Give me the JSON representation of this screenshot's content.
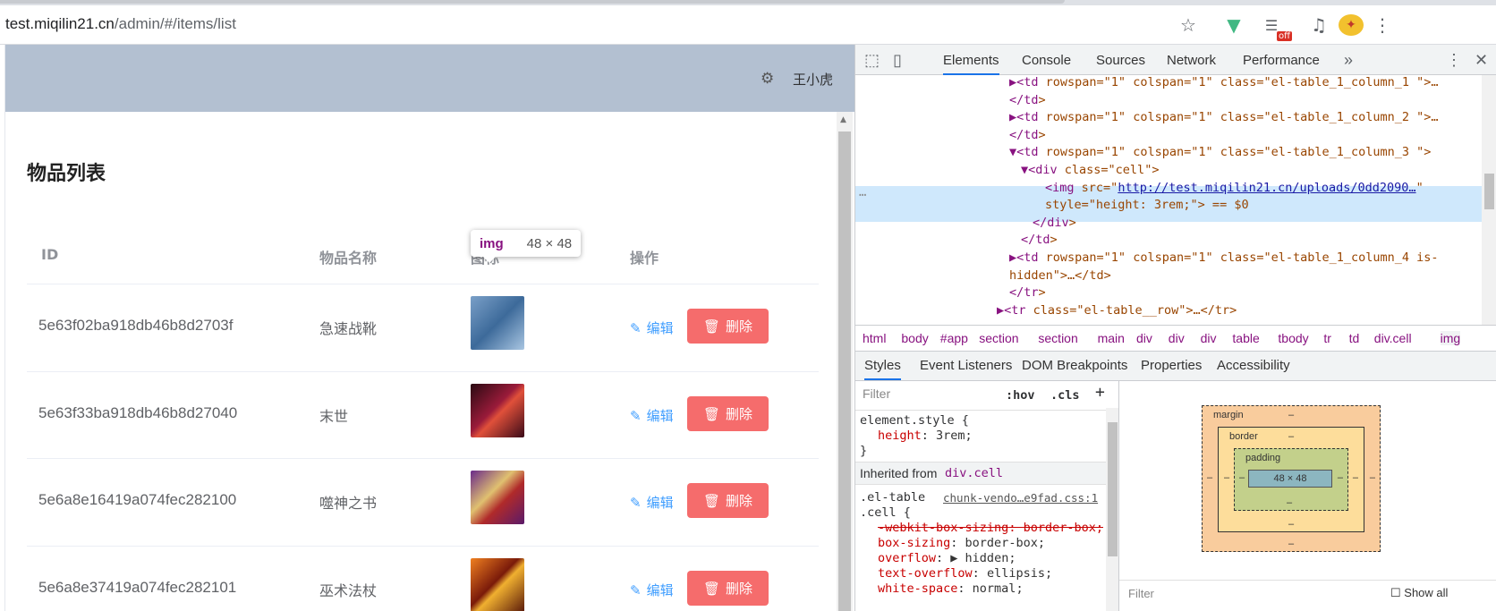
{
  "browser": {
    "url_host": "test.miqilin21.cn",
    "url_path": "/admin/#/items/list",
    "ext_badge": "off"
  },
  "app": {
    "user_name": "王小虎",
    "page_title": "物品列表",
    "columns": [
      "ID",
      "物品名称",
      "图标",
      "操作"
    ],
    "rows": [
      {
        "id": "5e63f02ba918db46b8d2703f",
        "name": "急速战靴",
        "icon": "item-icon-boots"
      },
      {
        "id": "5e63f33ba918db46b8d27040",
        "name": "末世",
        "icon": "item-icon-blade"
      },
      {
        "id": "5e6a8e16419a074fec282100",
        "name": "噬神之书",
        "icon": "item-icon-book"
      },
      {
        "id": "5e6a8e37419a074fec282101",
        "name": "巫术法杖",
        "icon": "item-icon-staff"
      }
    ],
    "edit_label": "编辑",
    "delete_label": "删除",
    "tooltip_tag": "img",
    "tooltip_dim": "48 × 48"
  },
  "devtools": {
    "tabs": [
      "Elements",
      "Console",
      "Sources",
      "Network",
      "Performance"
    ],
    "dom_lines": [
      {
        "pre": "▶<",
        "tag": "td",
        "rest": " rowspan=\"1\" colspan=\"1\" class=\"el-table_1_column_1  \">…"
      },
      {
        "pre": "</",
        "tag": "td",
        "rest": ">"
      },
      {
        "pre": "▶<",
        "tag": "td",
        "rest": " rowspan=\"1\" colspan=\"1\" class=\"el-table_1_column_2  \">…"
      },
      {
        "pre": "</",
        "tag": "td",
        "rest": ">"
      },
      {
        "pre": "▼<",
        "tag": "td",
        "rest": " rowspan=\"1\" colspan=\"1\" class=\"el-table_1_column_3  \">"
      },
      {
        "pre": "▼<",
        "tag": "div",
        "rest": " class=\"cell\">"
      },
      {
        "pre": "<",
        "tag": "img",
        "rest": " src=\"http://test.miqilin21.cn/uploads/0dd2090…\""
      },
      {
        "pre": "",
        "tag": "",
        "rest": "style=\"height: 3rem;\"> == $0"
      },
      {
        "pre": "</",
        "tag": "div",
        "rest": ">"
      },
      {
        "pre": "</",
        "tag": "td",
        "rest": ">"
      },
      {
        "pre": "▶<",
        "tag": "td",
        "rest": " rowspan=\"1\" colspan=\"1\" class=\"el-table_1_column_4   is-"
      },
      {
        "pre": "",
        "tag": "",
        "rest": "hidden\">…</td>"
      },
      {
        "pre": "</",
        "tag": "tr",
        "rest": ">"
      },
      {
        "pre": "▶<",
        "tag": "tr",
        "rest": " class=\"el-table__row\">…</tr>"
      }
    ],
    "breadcrumbs": [
      "html",
      "body",
      "#app",
      "section",
      "section",
      "main",
      "div",
      "div",
      "div",
      "table",
      "tbody",
      "tr",
      "td",
      "div.cell",
      "img"
    ],
    "styles_tabs": [
      "Styles",
      "Event Listeners",
      "DOM Breakpoints",
      "Properties",
      "Accessibility"
    ],
    "filter_placeholder": "Filter",
    "hov": ":hov",
    "cls": ".cls",
    "element_style": "element.style {",
    "element_prop": "height",
    "element_val": "3rem;",
    "inherited_label": "Inherited from",
    "inherited_from": "div.cell",
    "rule_selector_1": ".el-table",
    "rule_selector_2": ".cell {",
    "rule_source": "chunk-vendo…e9fad.css:1",
    "rule_props": [
      {
        "p": "-webkit-box-sizing",
        "v": "border-box;",
        "struck": true
      },
      {
        "p": "box-sizing",
        "v": "border-box;",
        "struck": false
      },
      {
        "p": "overflow",
        "v": "▶ hidden;",
        "struck": false
      },
      {
        "p": "text-overflow",
        "v": "ellipsis;",
        "struck": false
      },
      {
        "p": "white-space",
        "v": "normal;",
        "struck": false
      }
    ],
    "box_model": {
      "margin": "margin",
      "border": "border",
      "padding": "padding",
      "content": "48 × 48",
      "dash": "–"
    },
    "bottom_filter": "Filter",
    "show_all": "Show all"
  }
}
